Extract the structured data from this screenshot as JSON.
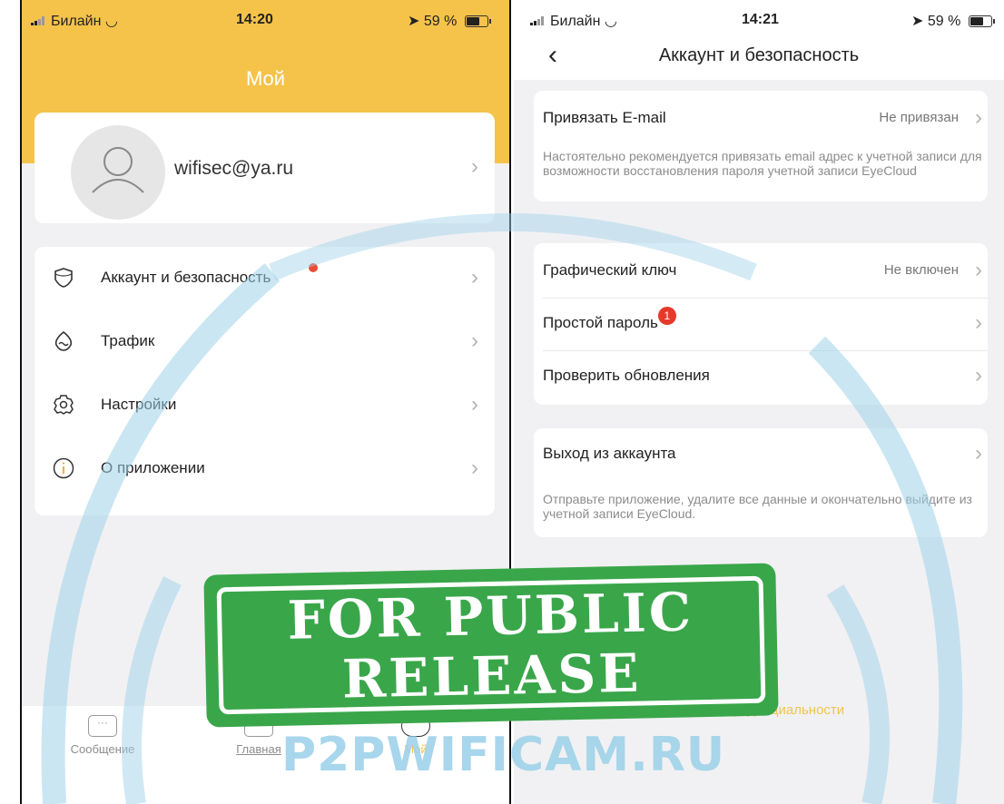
{
  "left": {
    "status": {
      "carrier": "Билайн",
      "time": "14:20",
      "battery": "59 %"
    },
    "title": "Мой",
    "profile": {
      "email": "wifisec@ya.ru"
    },
    "menu": [
      {
        "label": "Аккаунт и безопасность",
        "icon": "shield-icon",
        "dot": true
      },
      {
        "label": "Трафик",
        "icon": "traffic-icon"
      },
      {
        "label": "Настройки",
        "icon": "gear-icon"
      },
      {
        "label": "О приложении",
        "icon": "info-icon"
      }
    ],
    "tabs": [
      {
        "label": "Сообщение",
        "icon": "message-icon"
      },
      {
        "label": "Главная",
        "icon": "home-icon"
      },
      {
        "label": "Мой",
        "icon": "profile-icon",
        "active": true
      }
    ]
  },
  "right": {
    "status": {
      "carrier": "Билайн",
      "time": "14:21",
      "battery": "59 %"
    },
    "title": "Аккаунт и безопасность",
    "email_row": {
      "label": "Привязать E-mail",
      "value": "Не привязан"
    },
    "email_note": "Настоятельно рекомендуется привязать email адрес к учетной записи для возможности восстановления пароля учетной записи EyeCloud",
    "security": [
      {
        "label": "Графический ключ",
        "value": "Не включен"
      },
      {
        "label": "Простой пароль",
        "badge": "1"
      },
      {
        "label": "Проверить обновления"
      }
    ],
    "logout_row": {
      "label": "Выход из аккаунта"
    },
    "logout_note": "Отправьте приложение, удалите все данные и окончательно выйдите из учетной записи EyeCloud.",
    "privacy_link": "Соглашение о конфиденциальности"
  },
  "watermark": {
    "site": "P2PWIFICAM.RU",
    "stamp_line1": "FOR PUBLIC",
    "stamp_line2": "RELEASE"
  },
  "colors": {
    "accent_yellow": "#f5c34a",
    "stamp_green": "#3aa64a",
    "badge_red": "#e53a2b",
    "watermark_blue": "#9fd2ea"
  }
}
